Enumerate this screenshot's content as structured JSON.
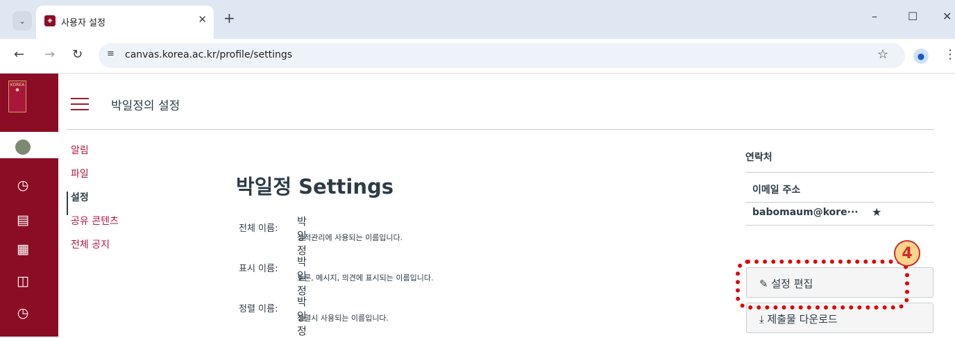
{
  "browser": {
    "tab_title": "사용자 설정",
    "url": "canvas.korea.ac.kr/profile/settings",
    "icons": [
      "tab-dropdown-icon",
      "close-icon",
      "plus-icon",
      "minimize-icon",
      "maximize-icon",
      "close-window-icon",
      "back-icon",
      "forward-icon",
      "reload-icon",
      "site-info-icon",
      "star-icon",
      "profile-icon",
      "menu-icon"
    ]
  },
  "global_nav": {
    "logo_text": "KOREA",
    "icons": [
      "dashboard-icon",
      "courses-icon",
      "calendar-icon",
      "inbox-icon",
      "history-icon"
    ]
  },
  "header": {
    "title": "박일정의 설정"
  },
  "section_nav": {
    "items": [
      {
        "label": "알림"
      },
      {
        "label": "파일"
      },
      {
        "label": "설정",
        "active": true
      },
      {
        "label": "공유 콘텐츠"
      },
      {
        "label": "전체 공지"
      }
    ]
  },
  "main": {
    "heading": "박일정 Settings",
    "fields": [
      {
        "label": "전체 이름:",
        "value": "박일정",
        "hint": "성적관리에 사용되는 이름입니다."
      },
      {
        "label": "표시 이름:",
        "value": "박일정",
        "hint": "토론, 메시지, 의견에 표시되는 이름입니다."
      },
      {
        "label": "정렬 이름:",
        "value": "박일정",
        "hint": "정렬시 사용되는 이름입니다."
      }
    ]
  },
  "aside": {
    "contacts_heading": "연락처",
    "email_heading": "이메일 주소",
    "email": "babomaum@kore···",
    "edit_settings_label": "설정 편집",
    "download_submissions_label": "제출물 다운로드"
  },
  "annotation": {
    "number": "4",
    "color": "#e00000"
  }
}
